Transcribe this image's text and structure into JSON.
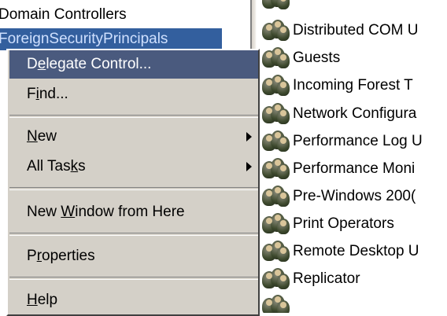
{
  "tree": {
    "items": [
      {
        "label": "Domain Controllers"
      },
      {
        "label": "ForeignSecurityPrincipals"
      }
    ]
  },
  "list": {
    "items": [
      {
        "label": "Distributed COM U"
      },
      {
        "label": "Guests"
      },
      {
        "label": "Incoming Forest T"
      },
      {
        "label": "Network Configura"
      },
      {
        "label": "Performance Log U"
      },
      {
        "label": "Performance Moni"
      },
      {
        "label": "Pre-Windows 200("
      },
      {
        "label": "Print Operators"
      },
      {
        "label": "Remote Desktop U"
      },
      {
        "label": "Replicator"
      }
    ],
    "icon": "group-icon"
  },
  "context_menu": {
    "items": [
      {
        "pre": "D",
        "u": "e",
        "post": "legate Control...",
        "highlighted": true
      },
      {
        "pre": "F",
        "u": "i",
        "post": "nd..."
      },
      {
        "pre": "",
        "u": "N",
        "post": "ew",
        "submenu": true
      },
      {
        "pre": "All Tas",
        "u": "k",
        "post": "s",
        "submenu": true
      },
      {
        "pre": "New ",
        "u": "W",
        "post": "indow from Here"
      },
      {
        "pre": "P",
        "u": "r",
        "post": "operties"
      },
      {
        "pre": "",
        "u": "H",
        "post": "elp"
      }
    ]
  },
  "colors": {
    "menu_bg": "#d4d0c8",
    "highlight": "#4a5a7e",
    "tree_selection": "#335f9e"
  }
}
